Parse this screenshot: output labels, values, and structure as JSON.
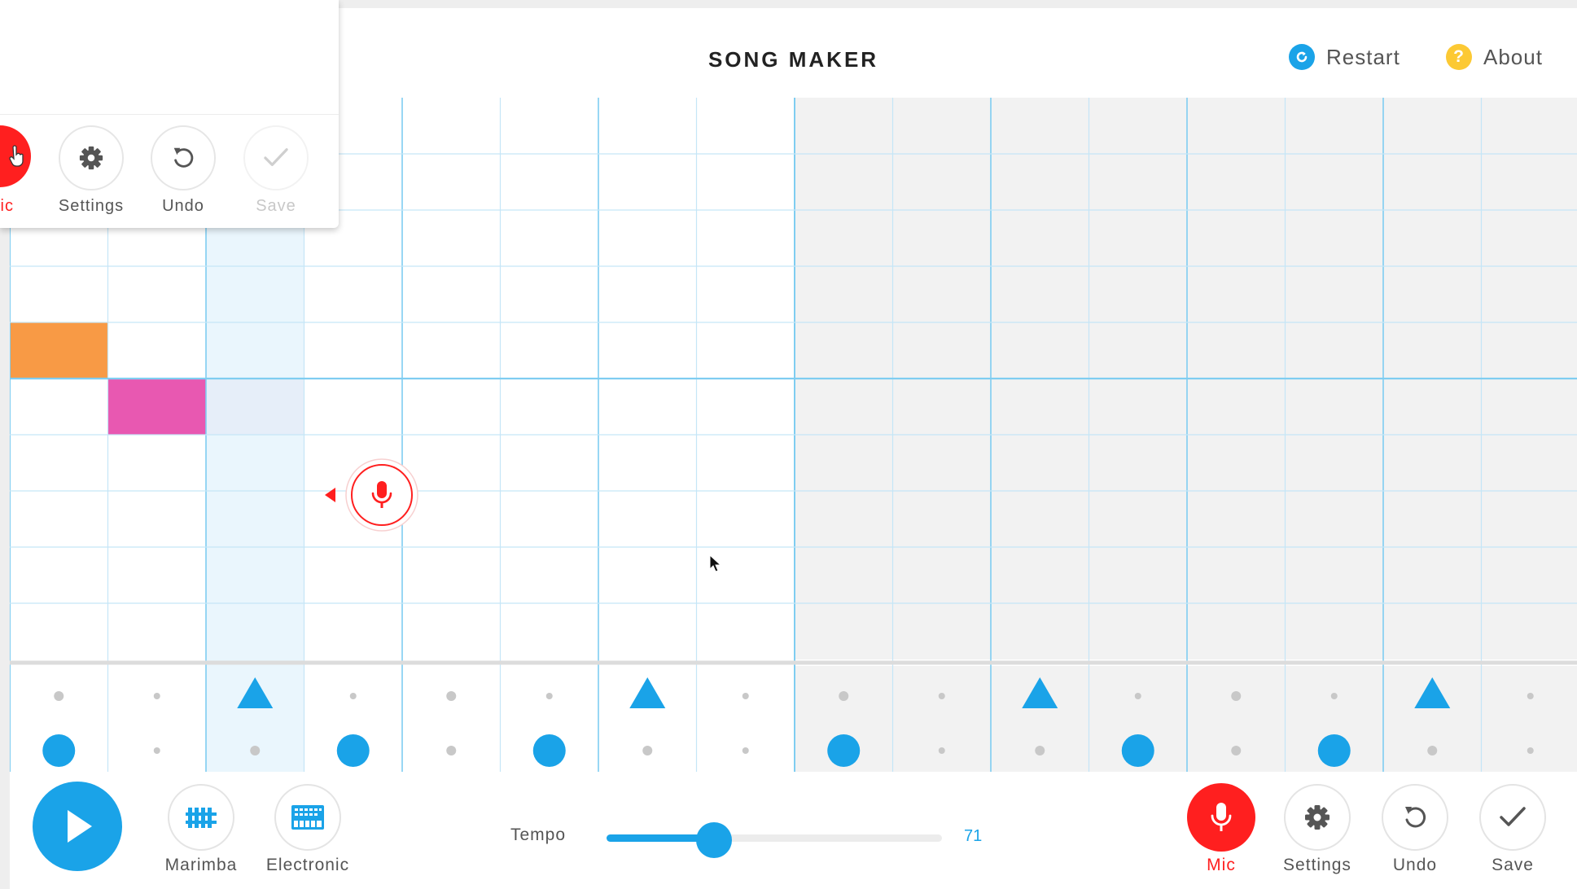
{
  "header": {
    "title": "SONG MAKER",
    "restart_label": "Restart",
    "about_label": "About"
  },
  "colors": {
    "accent": "#1aa3e8",
    "mic_red": "#ff1f1f",
    "note_orange": "#f89a45",
    "note_pink": "#e858b1",
    "grid_line": "#c5e6f7",
    "grid_line_strong": "#7fcdf1",
    "shaded_section": "#f2f2f2",
    "playhead_column": "#eaf6fd",
    "about_icon": "#fcc934"
  },
  "melody_grid": {
    "columns": 16,
    "rows": 10,
    "shaded_from_column": 8,
    "highlighted_column": 2,
    "notes": [
      {
        "column": 0,
        "row": 4,
        "color": "note_orange"
      },
      {
        "column": 1,
        "row": 5,
        "color": "note_pink"
      },
      {
        "column": 2,
        "row": 5,
        "color": "ghost"
      }
    ]
  },
  "rhythm": {
    "triangle_hits": [
      2,
      6,
      10,
      14
    ],
    "circle_hits": [
      0,
      3,
      5,
      8,
      11,
      13
    ]
  },
  "recording_indicator": {
    "icon": "mic-icon",
    "arrow": "left-arrow-icon"
  },
  "dock": {
    "play_icon": "play-icon",
    "instruments": [
      {
        "label": "Marimba",
        "icon": "marimba-icon"
      },
      {
        "label": "Electronic",
        "icon": "electronic-icon"
      }
    ],
    "tempo_label": "Tempo",
    "tempo_value": "71",
    "tempo_fraction": 0.32,
    "mic_label": "Mic",
    "settings_label": "Settings",
    "undo_label": "Undo",
    "save_label": "Save"
  },
  "popup": {
    "mic_label": "Mic",
    "settings_label": "Settings",
    "undo_label": "Undo",
    "save_label": "Save"
  }
}
